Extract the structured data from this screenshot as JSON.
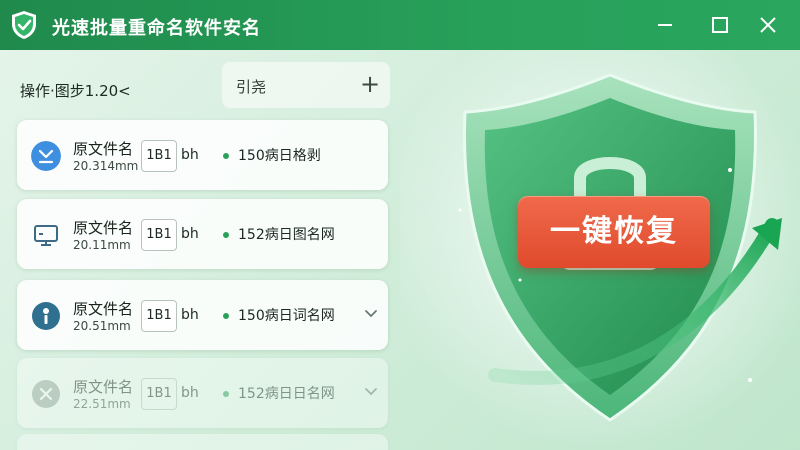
{
  "app": {
    "title": "光速批量重命名软件安名"
  },
  "toolbar": {
    "label": "操作·图步1.20<",
    "box_label": "引尧",
    "add_symbol": "+"
  },
  "files": [
    {
      "icon": "download-icon",
      "name": "原文件名",
      "size": "20.314mm",
      "box": "1B1",
      "suffix": "bh",
      "new_name": "150病日格剥",
      "chevron": false
    },
    {
      "icon": "monitor-icon",
      "name": "原文件名",
      "size": "20.11mm",
      "box": "1B1",
      "suffix": "bh",
      "new_name": "152病日图名网",
      "chevron": false
    },
    {
      "icon": "info-icon",
      "name": "原文件名",
      "size": "20.51mm",
      "box": "1B1",
      "suffix": "bh",
      "new_name": "150病日词名网",
      "chevron": true
    },
    {
      "icon": "close-circle-icon",
      "name": "原文件名",
      "size": "22.51mm",
      "box": "1B1",
      "suffix": "bh",
      "new_name": "152病日日名网",
      "chevron": true
    }
  ],
  "hero": {
    "restore_label": "一键恢复"
  },
  "colors": {
    "titlebar": "#27a05a",
    "accent": "#2aa05a",
    "restore_button": "#e8553a",
    "shield": "#2e9a58"
  }
}
